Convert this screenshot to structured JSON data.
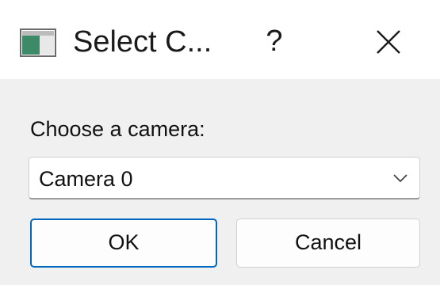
{
  "window": {
    "title": "Select C...",
    "help_label": "?",
    "icons": {
      "app": "app-window-icon",
      "close": "close-icon"
    }
  },
  "dialog": {
    "prompt": "Choose a camera:",
    "camera_select": {
      "selected": "Camera 0",
      "icon": "chevron-down-icon"
    },
    "ok_label": "OK",
    "cancel_label": "Cancel"
  },
  "colors": {
    "accent": "#0067c0",
    "client_background": "#f0f0f0"
  }
}
